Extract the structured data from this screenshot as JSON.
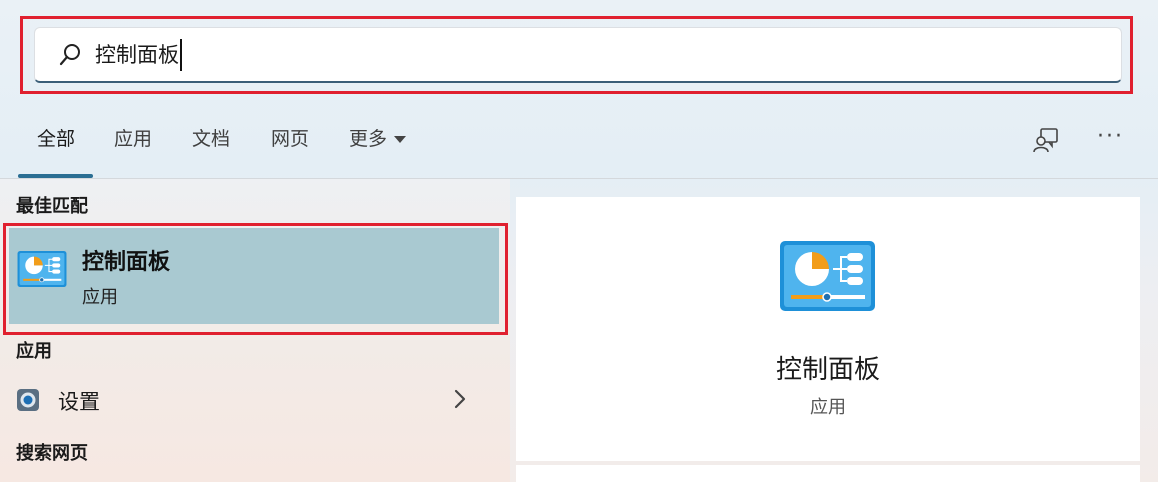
{
  "search": {
    "value": "控制面板"
  },
  "tabs": [
    {
      "label": "全部"
    },
    {
      "label": "应用"
    },
    {
      "label": "文档"
    },
    {
      "label": "网页"
    },
    {
      "label": "更多"
    }
  ],
  "more_options_label": "···",
  "sections": {
    "best_match": "最佳匹配",
    "apps": "应用",
    "web": "搜索网页"
  },
  "best_match": {
    "title": "控制面板",
    "subtitle": "应用",
    "icon": "control-panel-icon"
  },
  "apps": [
    {
      "label": "设置",
      "icon": "settings-icon"
    }
  ],
  "detail": {
    "title": "控制面板",
    "subtitle": "应用",
    "icon": "control-panel-icon"
  },
  "colors": {
    "highlight": "#e0202f",
    "selected_bg": "#a9c9d1",
    "accent": "#2a6e93"
  }
}
